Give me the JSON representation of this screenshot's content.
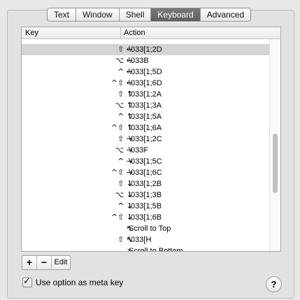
{
  "tabs": [
    "Text",
    "Window",
    "Shell",
    "Keyboard",
    "Advanced"
  ],
  "active_tab": "Keyboard",
  "table": {
    "col_key": "Key",
    "col_action": "Action",
    "rows": [
      {
        "key": "⇧ ←",
        "action": "\\033[1;2D",
        "selected": true
      },
      {
        "key": "⌥ ←",
        "action": "\\033B"
      },
      {
        "key": "^ ←",
        "action": "\\033[1;5D"
      },
      {
        "key": "^⇧ ←",
        "action": "\\033[1;6D"
      },
      {
        "key": "⇧ ↑",
        "action": "\\033[1;2A"
      },
      {
        "key": "⌥ ↑",
        "action": "\\033[1;3A"
      },
      {
        "key": "^ ↑",
        "action": "\\033[1;5A"
      },
      {
        "key": "^⇧ ↑",
        "action": "\\033[1;6A"
      },
      {
        "key": "⇧ →",
        "action": "\\033[1;2C"
      },
      {
        "key": "⌥ →",
        "action": "\\033F"
      },
      {
        "key": "^ →",
        "action": "\\033[1;5C"
      },
      {
        "key": "^⇧ →",
        "action": "\\033[1;6C"
      },
      {
        "key": "⇧ ↓",
        "action": "\\033[1;2B"
      },
      {
        "key": "⌥ ↓",
        "action": "\\033[1;3B"
      },
      {
        "key": "^ ↓",
        "action": "\\033[1;5B"
      },
      {
        "key": "^⇧ ↓",
        "action": "\\033[1;6B"
      },
      {
        "key": "↖",
        "action": "Scroll to Top"
      },
      {
        "key": "⇧ ↖",
        "action": "\\033[H"
      },
      {
        "key": "↘",
        "action": "Scroll to Bottom"
      }
    ]
  },
  "buttons": {
    "add": "+",
    "remove": "−",
    "edit": "Edit"
  },
  "option_meta": {
    "label": "Use option as meta key",
    "checked": true
  },
  "help_label": "?",
  "scrollbar": {
    "position": 0.62,
    "visible_fraction": 0.28
  }
}
